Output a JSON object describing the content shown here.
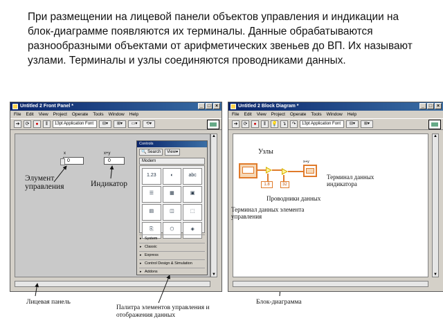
{
  "intro_text": "При размещении на лицевой панели объектов управления и индикации на блок-диаграмме появляются их терминалы. Данные обрабатываются разнообразными объектами от арифметических звеньев до ВП. Их называют узлами. Терминалы и узлы соединяются проводниками данных.",
  "front_panel": {
    "title": "Untitled 2 Front Panel *",
    "menu": [
      "File",
      "Edit",
      "View",
      "Project",
      "Operate",
      "Tools",
      "Window",
      "Help"
    ],
    "font_select": "13pt Application Font",
    "control_label": "x",
    "control_value": "0",
    "indicator_label": "x+y",
    "indicator_value": "0",
    "ann_control": "Элумент управления",
    "ann_indicator": "Индикатор"
  },
  "palette": {
    "title": "Controls",
    "search": "Search",
    "view": "View",
    "section": "Modern",
    "categories": [
      "System",
      "Classic",
      "Express",
      "Control Design & Simulation",
      "Addons"
    ]
  },
  "block_diagram": {
    "title": "Untitled 2 Block Diagram *",
    "menu": [
      "File",
      "Edit",
      "View",
      "Project",
      "Operate",
      "Tools",
      "Window",
      "Help"
    ],
    "font_select": "13pt Application Font",
    "const1": "1.8",
    "const2": "32",
    "indicator_label": "x+y",
    "ann_nodes": "Узлы",
    "ann_indicator_terminal": "Терминал данных индикатора",
    "ann_wires": "Проводники данных",
    "ann_control_terminal": "Терминал данных элемента управления"
  },
  "captions": {
    "front_panel": "Лицевая панель",
    "palette": "Палитра элементов управления и отображения данных",
    "block_diagram": "Блок-диаграмма"
  }
}
